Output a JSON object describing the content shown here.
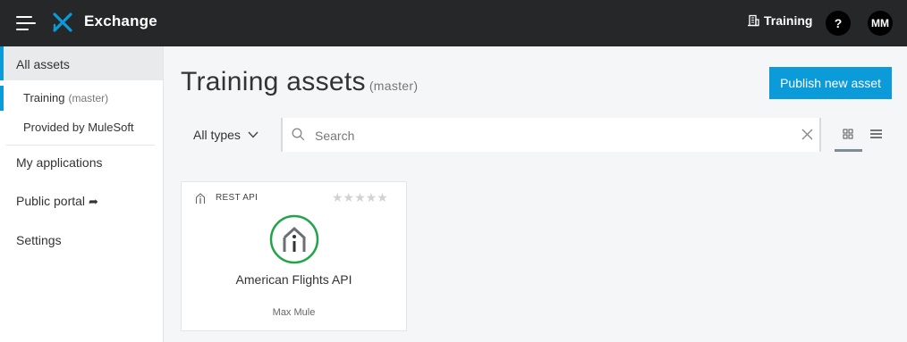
{
  "header": {
    "app_title": "Exchange",
    "org_label": "Training",
    "help_label": "?",
    "avatar_initials": "MM",
    "background_color": "#262728",
    "logo_color": "#0a9bd8"
  },
  "sidebar": {
    "all_assets": "All assets",
    "training_label": "Training",
    "training_sub": "(master)",
    "provided": "Provided by MuleSoft",
    "my_applications": "My applications",
    "public_portal": "Public portal",
    "public_portal_icon": "share-arrow-icon",
    "settings": "Settings",
    "accent_color": "#0a9bd8"
  },
  "main": {
    "title": "Training assets",
    "title_sub": "(master)",
    "publish_button": "Publish new asset",
    "publish_color": "#0b9bd9",
    "filter": {
      "types_label": "All types",
      "search_placeholder": "Search",
      "view_mode": "grid"
    },
    "assets": [
      {
        "type_label": "REST API",
        "name": "American Flights API",
        "author": "Max Mule",
        "stars": "★★★★★",
        "rating": 0,
        "logo_ring_color": "#22a34a"
      }
    ]
  }
}
